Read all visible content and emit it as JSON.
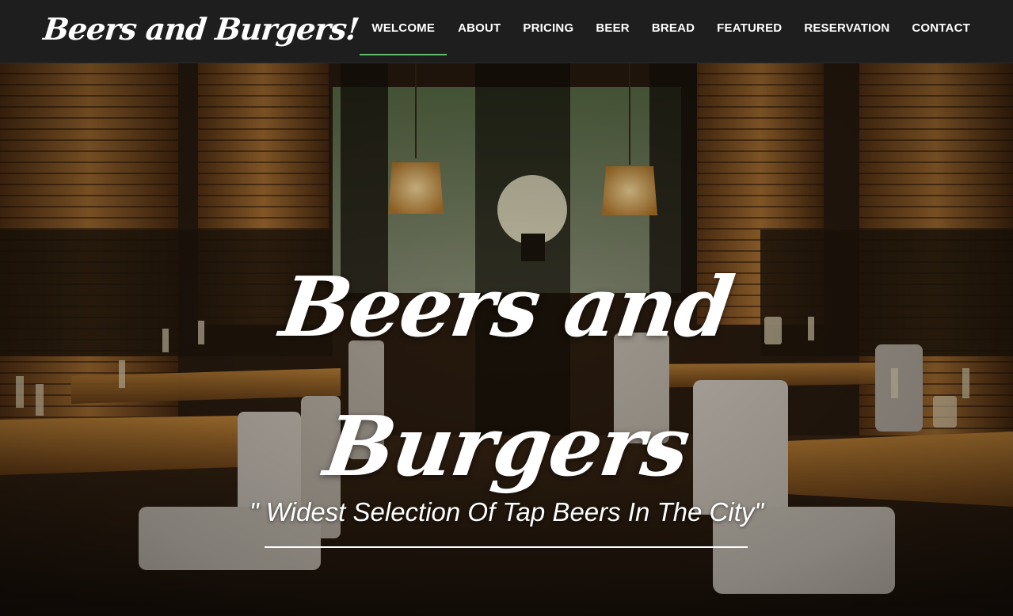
{
  "brand": {
    "title": "Beers and Burgers!"
  },
  "nav": {
    "items": [
      {
        "label": "WELCOME",
        "active": true
      },
      {
        "label": "ABOUT"
      },
      {
        "label": "PRICING"
      },
      {
        "label": "BEER"
      },
      {
        "label": "BREAD"
      },
      {
        "label": "FEATURED"
      },
      {
        "label": "RESERVATION"
      },
      {
        "label": "CONTACT"
      }
    ],
    "active_color": "#5fbf6a"
  },
  "hero": {
    "title_line1": "Beers and",
    "title_line2": "Burgers",
    "tagline": "\" Widest Selection Of Tap Beers In The City\""
  },
  "colors": {
    "navbar_bg": "#1e1e1e",
    "text": "#ffffff",
    "accent": "#5fbf6a"
  }
}
